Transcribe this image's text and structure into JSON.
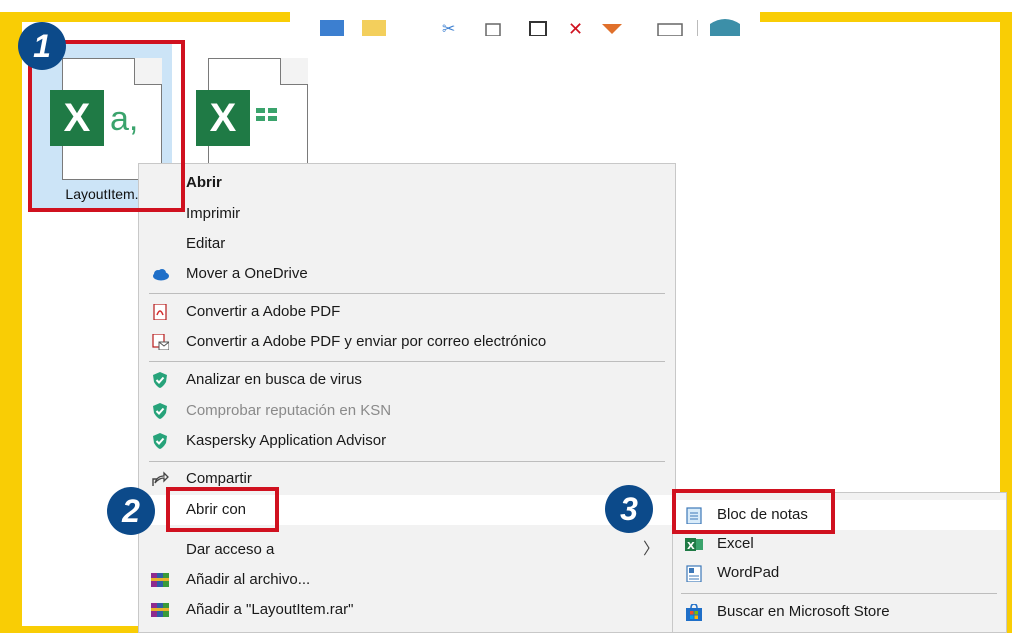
{
  "files": [
    {
      "label": "LayoutItem.",
      "glyph": "X",
      "suffix": "a,",
      "selected": true
    },
    {
      "label": "",
      "glyph": "X",
      "suffix": "",
      "selected": false
    }
  ],
  "context_menu": {
    "items": [
      {
        "label": "Abrir",
        "icon": "",
        "bold": true
      },
      {
        "label": "Imprimir",
        "icon": ""
      },
      {
        "label": "Editar",
        "icon": ""
      },
      {
        "label": "Mover a OneDrive",
        "icon": "cloud-icon"
      },
      {
        "label": "Convertir a Adobe PDF",
        "icon": "adobe-pdf-icon"
      },
      {
        "label": "Convertir a Adobe PDF y enviar por correo electrónico",
        "icon": "adobe-pdf-mail-icon"
      },
      {
        "label": "Analizar en busca de virus",
        "icon": "kaspersky-shield-icon"
      },
      {
        "label": "Comprobar reputación en KSN",
        "icon": "kaspersky-shield-icon",
        "disabled": true
      },
      {
        "label": "Kaspersky Application Advisor",
        "icon": "kaspersky-shield-icon"
      },
      {
        "label": "Compartir",
        "icon": "share-icon"
      },
      {
        "label": "Abrir con",
        "icon": "",
        "submenu": true,
        "highlighted": true
      },
      {
        "label": "Dar acceso a",
        "icon": "",
        "submenu": true
      },
      {
        "label": "Añadir al archivo...",
        "icon": "winrar-icon"
      },
      {
        "label": "Añadir a \"LayoutItem.rar\"",
        "icon": "winrar-icon"
      }
    ]
  },
  "open_with_submenu": {
    "items": [
      {
        "label": "Bloc de notas",
        "icon": "notepad-icon",
        "highlighted": true
      },
      {
        "label": "Excel",
        "icon": "excel-icon"
      },
      {
        "label": "WordPad",
        "icon": "wordpad-icon"
      },
      {
        "label": "Buscar en Microsoft Store",
        "icon": "store-icon"
      }
    ]
  },
  "steps": [
    "1",
    "2",
    "3"
  ],
  "colors": {
    "frame": "#f9cd05",
    "highlight_box": "#d0111f",
    "badge": "#0c4a8a",
    "excel_green": "#1f7a45"
  }
}
